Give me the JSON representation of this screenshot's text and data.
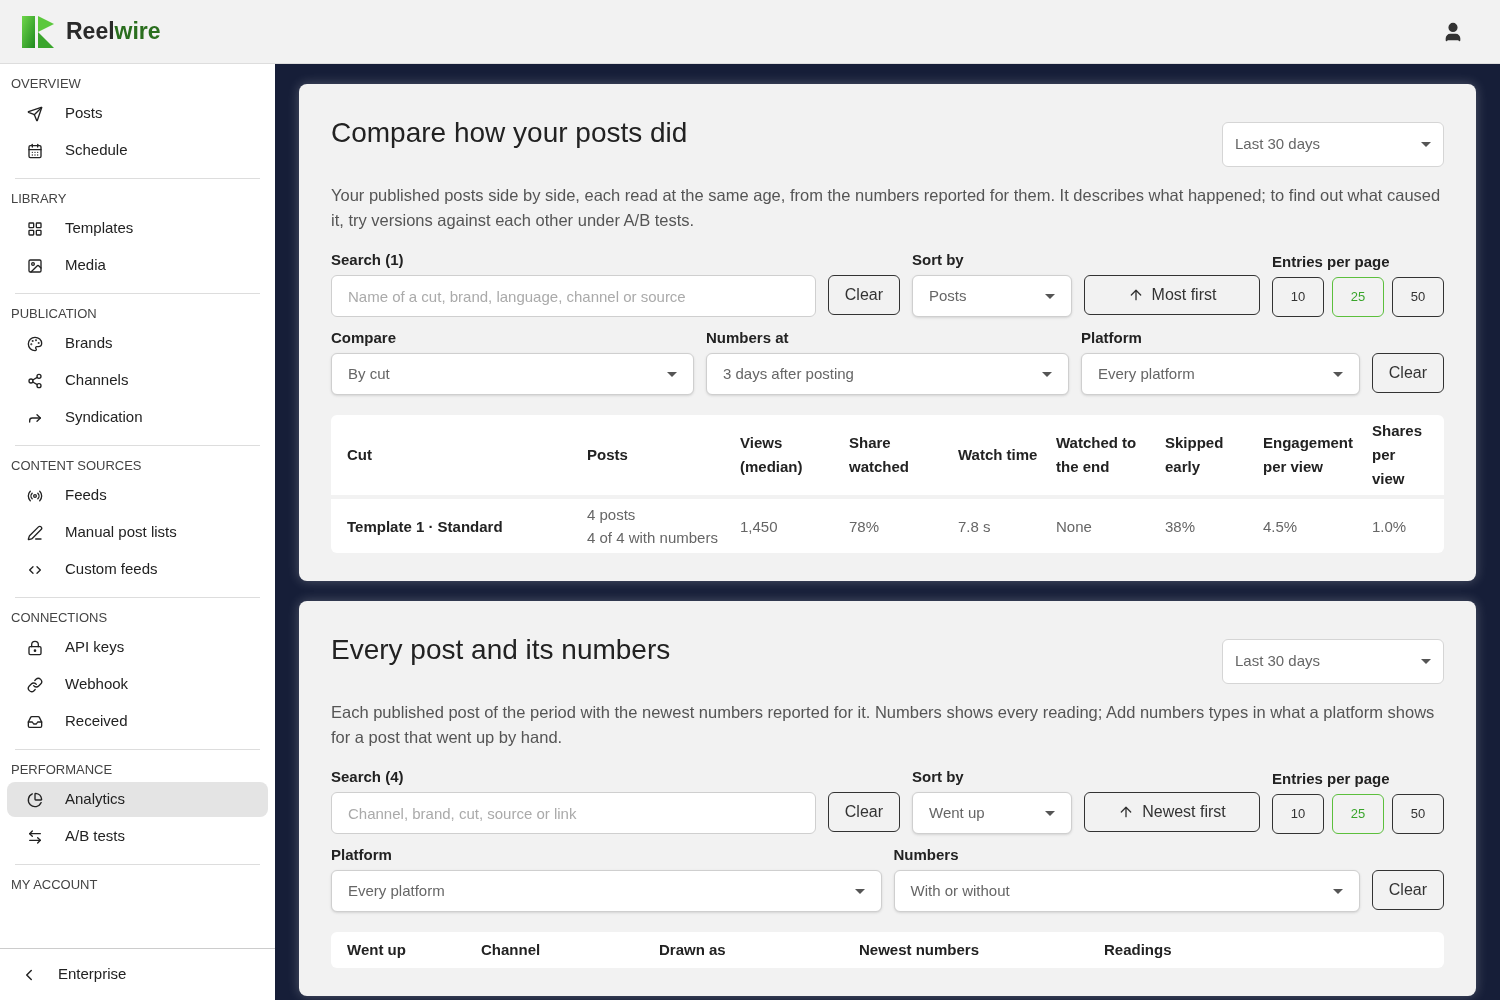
{
  "brand": {
    "first": "Reel",
    "second": "wire"
  },
  "sidebar": {
    "groups": [
      {
        "title": "OVERVIEW",
        "items": [
          {
            "label": "Posts",
            "selected": false
          },
          {
            "label": "Schedule",
            "selected": false
          }
        ]
      },
      {
        "title": "LIBRARY",
        "items": [
          {
            "label": "Templates",
            "selected": false
          },
          {
            "label": "Media",
            "selected": false
          }
        ]
      },
      {
        "title": "PUBLICATION",
        "items": [
          {
            "label": "Brands",
            "selected": false
          },
          {
            "label": "Channels",
            "selected": false
          },
          {
            "label": "Syndication",
            "selected": false
          }
        ]
      },
      {
        "title": "CONTENT SOURCES",
        "items": [
          {
            "label": "Feeds",
            "selected": false
          },
          {
            "label": "Manual post lists",
            "selected": false
          },
          {
            "label": "Custom feeds",
            "selected": false
          }
        ]
      },
      {
        "title": "CONNECTIONS",
        "items": [
          {
            "label": "API keys",
            "selected": false
          },
          {
            "label": "Webhook",
            "selected": false
          },
          {
            "label": "Received",
            "selected": false
          }
        ]
      },
      {
        "title": "PERFORMANCE",
        "items": [
          {
            "label": "Analytics",
            "selected": true
          },
          {
            "label": "A/B tests",
            "selected": false
          }
        ]
      },
      {
        "title": "MY ACCOUNT"
      }
    ],
    "footer": {
      "label": "Enterprise"
    }
  },
  "sections": [
    {
      "title": "Compare how your posts did",
      "period": "Last 30 days",
      "description": "Your published posts side by side, each read at the same age, from the numbers reported for them. It describes what happened; to find out what caused it, try versions against each other under A/B tests.",
      "filter_lines": [
        {
          "groups": [
            {
              "kind": "search",
              "label": "Search (1)",
              "placeholder": "Name of a cut, brand, language, channel or source",
              "clear": "Clear"
            },
            {
              "kind": "sort",
              "label": "Sort by",
              "value": "Posts",
              "order": "Most first"
            },
            {
              "kind": "pages",
              "label": "Entries per page",
              "options": [
                {
                  "label": "10",
                  "selected": false
                },
                {
                  "label": "25",
                  "selected": true
                },
                {
                  "label": "50",
                  "selected": false
                }
              ]
            }
          ]
        },
        {
          "groups": [
            {
              "kind": "select",
              "label": "Compare",
              "value": "By cut"
            },
            {
              "kind": "select",
              "label": "Numbers at",
              "value": "3 days after posting"
            },
            {
              "kind": "select",
              "label": "Platform",
              "value": "Every platform",
              "clear": "Clear"
            }
          ]
        }
      ],
      "table": {
        "columns": [
          "Cut",
          "Posts",
          "Views (median)",
          "Share watched",
          "Watch time",
          "Watched to the end",
          "Skipped early",
          "Engagement per view",
          "Shares per view"
        ],
        "rows": [
          [
            "Template 1 · Standard",
            "4 posts\n4 of 4 with numbers",
            "1,450",
            "78%",
            "7.8 s",
            "None",
            "38%",
            "4.5%",
            "1.0%"
          ]
        ]
      }
    },
    {
      "title": "Every post and its numbers",
      "period": "Last 30 days",
      "description": "Each published post of the period with the newest numbers reported for it. Numbers shows every reading; Add numbers types in what a platform shows for a post that went up by hand.",
      "filter_lines": [
        {
          "groups": [
            {
              "kind": "search",
              "label": "Search (4)",
              "placeholder": "Channel, brand, cut, source or link",
              "clear": "Clear"
            },
            {
              "kind": "sort",
              "label": "Sort by",
              "value": "Went up",
              "order": "Newest first"
            },
            {
              "kind": "pages",
              "label": "Entries per page",
              "options": [
                {
                  "label": "10",
                  "selected": false
                },
                {
                  "label": "25",
                  "selected": true
                },
                {
                  "label": "50",
                  "selected": false
                }
              ]
            }
          ]
        },
        {
          "groups": [
            {
              "kind": "select",
              "label": "Platform",
              "value": "Every platform"
            },
            {
              "kind": "select",
              "label": "Numbers",
              "value": "With or without",
              "clear": "Clear"
            }
          ]
        }
      ],
      "table": {
        "columns": [
          "Went up",
          "Channel",
          "Drawn as",
          "Newest numbers",
          "Readings"
        ]
      }
    }
  ]
}
